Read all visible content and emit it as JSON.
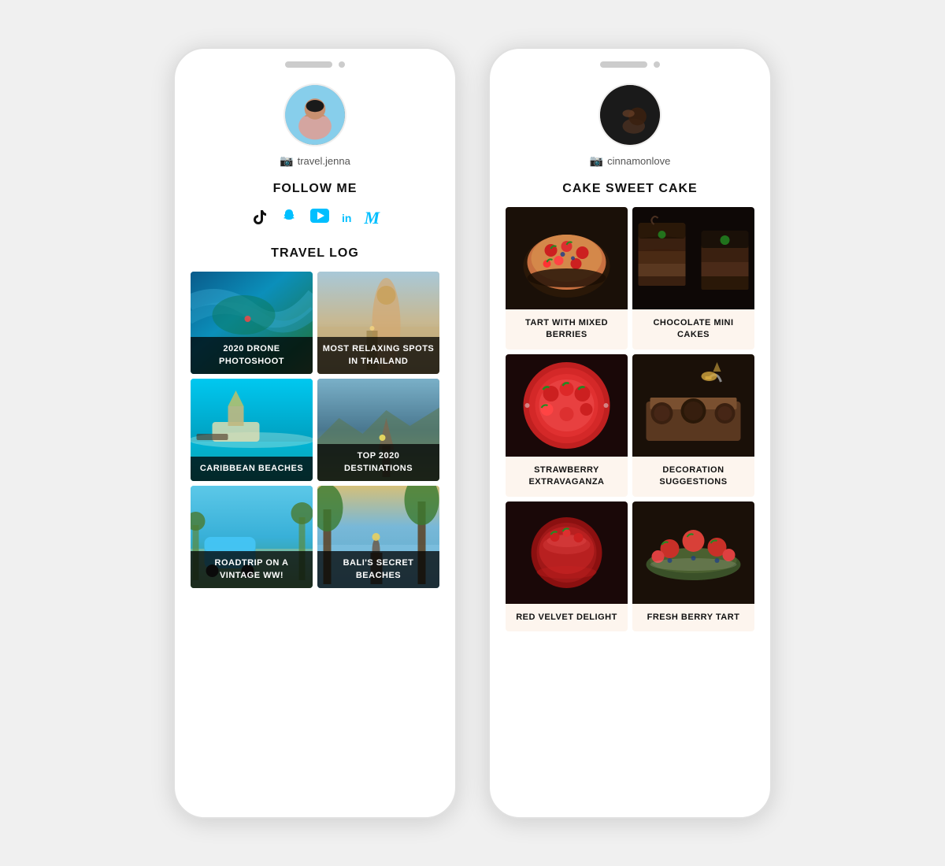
{
  "phone1": {
    "username": "travel.jenna",
    "follow_label": "FOLLOW ME",
    "travel_log_label": "TRAVEL LOG",
    "social_icons": [
      {
        "name": "tiktok",
        "symbol": "♪",
        "label": "TikTok"
      },
      {
        "name": "snapchat",
        "symbol": "👻",
        "label": "Snapchat"
      },
      {
        "name": "youtube",
        "symbol": "▶",
        "label": "YouTube"
      },
      {
        "name": "linkedin",
        "symbol": "in",
        "label": "LinkedIn"
      },
      {
        "name": "medium",
        "symbol": "M",
        "label": "Medium"
      }
    ],
    "posts": [
      {
        "id": "drone",
        "caption": "2020 DRONE PHOTOSHOOT"
      },
      {
        "id": "thailand",
        "caption": "MOST RELAXING SPOTS IN THAILAND"
      },
      {
        "id": "caribbean",
        "caption": "CARIBBEAN BEACHES"
      },
      {
        "id": "destinations",
        "caption": "TOP 2020 DESTINATIONS"
      },
      {
        "id": "roadtrip",
        "caption": "ROADTRIP ON A VINTAGE WW!"
      },
      {
        "id": "bali",
        "caption": "BALI'S SECRET BEACHES"
      }
    ]
  },
  "phone2": {
    "username": "cinnamonlove",
    "blog_label": "CAKE SWEET CAKE",
    "posts": [
      {
        "id": "tart",
        "caption": "TART WITH MIXED BERRIES"
      },
      {
        "id": "chocmini",
        "caption": "CHOCOLATE MINI CAKES"
      },
      {
        "id": "strawberry",
        "caption": "STRAWBERRY EXTRAVAGANZA"
      },
      {
        "id": "decoration",
        "caption": "DECORATION SUGGESTIONS"
      },
      {
        "id": "cake5",
        "caption": "RED VELVET DELIGHT"
      },
      {
        "id": "cake6",
        "caption": "FRESH BERRY TART"
      }
    ]
  }
}
